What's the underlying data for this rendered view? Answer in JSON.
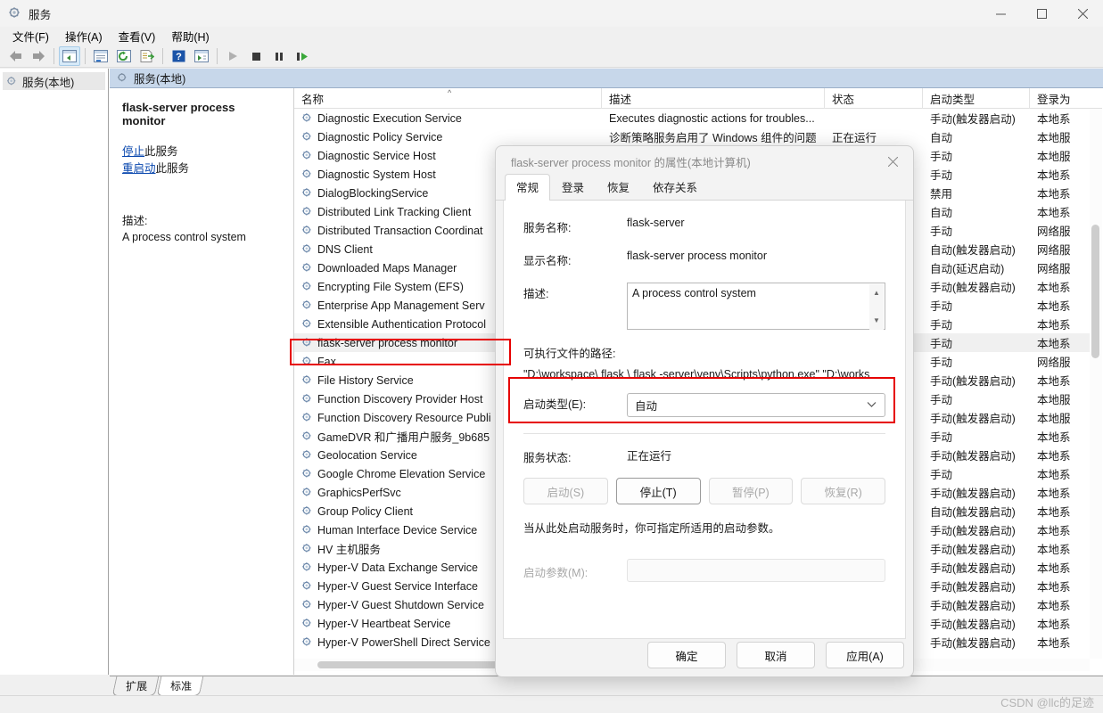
{
  "window": {
    "title": "服务",
    "icon": "services-gear-icon",
    "minimize": "—",
    "maximize": "▢",
    "close": "✕"
  },
  "menubar": [
    {
      "label": "文件(F)",
      "name": "menu-file"
    },
    {
      "label": "操作(A)",
      "name": "menu-action"
    },
    {
      "label": "查看(V)",
      "name": "menu-view"
    },
    {
      "label": "帮助(H)",
      "name": "menu-help"
    }
  ],
  "toolbar": [
    {
      "name": "back-icon"
    },
    {
      "name": "forward-icon"
    },
    {
      "name": "show-hide-tree-icon"
    },
    {
      "name": "properties-icon"
    },
    {
      "name": "refresh-icon"
    },
    {
      "name": "export-list-icon"
    },
    {
      "name": "help-icon"
    },
    {
      "name": "show-action-pane-icon"
    },
    {
      "name": "start-service-icon"
    },
    {
      "name": "stop-service-icon"
    },
    {
      "name": "pause-service-icon"
    },
    {
      "name": "restart-service-icon"
    }
  ],
  "tree": {
    "root_label": "服务(本地)"
  },
  "pane_header": {
    "label": "服务(本地)"
  },
  "detail": {
    "title": "flask-server process monitor",
    "stop_link_underlined": "停止",
    "stop_link_rest": "此服务",
    "restart_link_underlined": "重启动",
    "restart_link_rest": "此服务",
    "description_label": "描述:",
    "description_text": "A process control system"
  },
  "list": {
    "columns": [
      {
        "label": "名称",
        "name": "column-name",
        "sort": "^"
      },
      {
        "label": "描述",
        "name": "column-description"
      },
      {
        "label": "状态",
        "name": "column-status"
      },
      {
        "label": "启动类型",
        "name": "column-startup-type"
      },
      {
        "label": "登录为",
        "name": "column-log-on-as"
      }
    ],
    "rows": [
      {
        "name": "Diagnostic Execution Service",
        "desc": "Executes diagnostic actions for troubles...",
        "status": "",
        "start": "手动(触发器启动)",
        "logon": "本地系"
      },
      {
        "name": "Diagnostic Policy Service",
        "desc": "诊断策略服务启用了 Windows 组件的问题",
        "status": "正在运行",
        "start": "自动",
        "logon": "本地服"
      },
      {
        "name": "Diagnostic Service Host",
        "desc": "",
        "status": "",
        "start": "手动",
        "logon": "本地服"
      },
      {
        "name": "Diagnostic System Host",
        "desc": "",
        "status": "",
        "start": "手动",
        "logon": "本地系"
      },
      {
        "name": "DialogBlockingService",
        "desc": "",
        "status": "",
        "start": "禁用",
        "logon": "本地系"
      },
      {
        "name": "Distributed Link Tracking Client",
        "desc": "",
        "status": "",
        "start": "自动",
        "logon": "本地系"
      },
      {
        "name": "Distributed Transaction Coordinat",
        "desc": "",
        "status": "",
        "start": "手动",
        "logon": "网络服"
      },
      {
        "name": "DNS Client",
        "desc": "",
        "status": "",
        "start": "自动(触发器启动)",
        "logon": "网络服"
      },
      {
        "name": "Downloaded Maps Manager",
        "desc": "",
        "status": "",
        "start": "自动(延迟启动)",
        "logon": "网络服"
      },
      {
        "name": "Encrypting File System (EFS)",
        "desc": "",
        "status": "",
        "start": "手动(触发器启动)",
        "logon": "本地系"
      },
      {
        "name": "Enterprise App Management Serv",
        "desc": "",
        "status": "",
        "start": "手动",
        "logon": "本地系"
      },
      {
        "name": "Extensible Authentication Protocol",
        "desc": "",
        "status": "",
        "start": "手动",
        "logon": "本地系"
      },
      {
        "name": "flask-server process monitor",
        "desc": "",
        "status": "",
        "start": "手动",
        "logon": "本地系",
        "selected": true
      },
      {
        "name": "Fax",
        "desc": "",
        "status": "",
        "start": "手动",
        "logon": "网络服"
      },
      {
        "name": "File History Service",
        "desc": "",
        "status": "",
        "start": "手动(触发器启动)",
        "logon": "本地系"
      },
      {
        "name": "Function Discovery Provider Host",
        "desc": "",
        "status": "",
        "start": "手动",
        "logon": "本地服"
      },
      {
        "name": "Function Discovery Resource Publi",
        "desc": "",
        "status": "",
        "start": "手动(触发器启动)",
        "logon": "本地服"
      },
      {
        "name": "GameDVR 和广播用户服务_9b685",
        "desc": "",
        "status": "",
        "start": "手动",
        "logon": "本地系"
      },
      {
        "name": "Geolocation Service",
        "desc": "",
        "status": "",
        "start": "手动(触发器启动)",
        "logon": "本地系"
      },
      {
        "name": "Google Chrome Elevation Service",
        "desc": "",
        "status": "",
        "start": "手动",
        "logon": "本地系"
      },
      {
        "name": "GraphicsPerfSvc",
        "desc": "",
        "status": "",
        "start": "手动(触发器启动)",
        "logon": "本地系"
      },
      {
        "name": "Group Policy Client",
        "desc": "",
        "status": "",
        "start": "自动(触发器启动)",
        "logon": "本地系"
      },
      {
        "name": "Human Interface Device Service",
        "desc": "",
        "status": "",
        "start": "手动(触发器启动)",
        "logon": "本地系"
      },
      {
        "name": "HV 主机服务",
        "desc": "",
        "status": "",
        "start": "手动(触发器启动)",
        "logon": "本地系"
      },
      {
        "name": "Hyper-V Data Exchange Service",
        "desc": "",
        "status": "",
        "start": "手动(触发器启动)",
        "logon": "本地系"
      },
      {
        "name": "Hyper-V Guest Service Interface",
        "desc": "",
        "status": "",
        "start": "手动(触发器启动)",
        "logon": "本地系"
      },
      {
        "name": "Hyper-V Guest Shutdown Service",
        "desc": "",
        "status": "",
        "start": "手动(触发器启动)",
        "logon": "本地系"
      },
      {
        "name": "Hyper-V Heartbeat Service",
        "desc": "",
        "status": "",
        "start": "手动(触发器启动)",
        "logon": "本地系"
      },
      {
        "name": "Hyper-V PowerShell Direct Service",
        "desc": "",
        "status": "",
        "start": "手动(触发器启动)",
        "logon": "本地系"
      }
    ]
  },
  "bottom_tabs": [
    {
      "label": "扩展",
      "name": "tab-extended",
      "active": false
    },
    {
      "label": "标准",
      "name": "tab-standard",
      "active": true
    }
  ],
  "watermark": "CSDN @llc的足迹",
  "dialog": {
    "title": "flask-server process monitor 的属性(本地计算机)",
    "close": "✕",
    "tabs": [
      {
        "label": "常规",
        "name": "dialog-tab-general",
        "active": true
      },
      {
        "label": "登录",
        "name": "dialog-tab-logon",
        "active": false
      },
      {
        "label": "恢复",
        "name": "dialog-tab-recovery",
        "active": false
      },
      {
        "label": "依存关系",
        "name": "dialog-tab-dependencies",
        "active": false
      }
    ],
    "service_name_label": "服务名称:",
    "service_name_value": "flask-server",
    "display_name_label": "显示名称:",
    "display_name_value": "flask-server process monitor",
    "description_label": "描述:",
    "description_value": "A process control system",
    "scroll_up": "▲",
    "scroll_down": "▼",
    "path_label": "可执行文件的路径:",
    "path_value": "\"D:\\workspace\\ flask \\ flask -server\\venv\\Scripts\\python.exe\" \"D:\\works",
    "startup_type_label": "启动类型(E):",
    "startup_type_value": "自动",
    "startup_type_chevron": "⌄",
    "service_status_label": "服务状态:",
    "service_status_value": "正在运行",
    "buttons": [
      {
        "label": "启动(S)",
        "name": "start-button",
        "enabled": false
      },
      {
        "label": "停止(T)",
        "name": "stop-button",
        "enabled": true
      },
      {
        "label": "暂停(P)",
        "name": "pause-button",
        "enabled": false
      },
      {
        "label": "恢复(R)",
        "name": "resume-button",
        "enabled": false
      }
    ],
    "hint": "当从此处启动服务时，你可指定所适用的启动参数。",
    "start_params_label": "启动参数(M):",
    "start_params_value": "",
    "footer": [
      {
        "label": "确定",
        "name": "ok-button"
      },
      {
        "label": "取消",
        "name": "cancel-button"
      },
      {
        "label": "应用(A)",
        "name": "apply-button"
      }
    ]
  },
  "colors": {
    "highlight_red": "#e60000",
    "link_blue": "#0645ad",
    "pane_header_blue": "#c7d7ea"
  }
}
